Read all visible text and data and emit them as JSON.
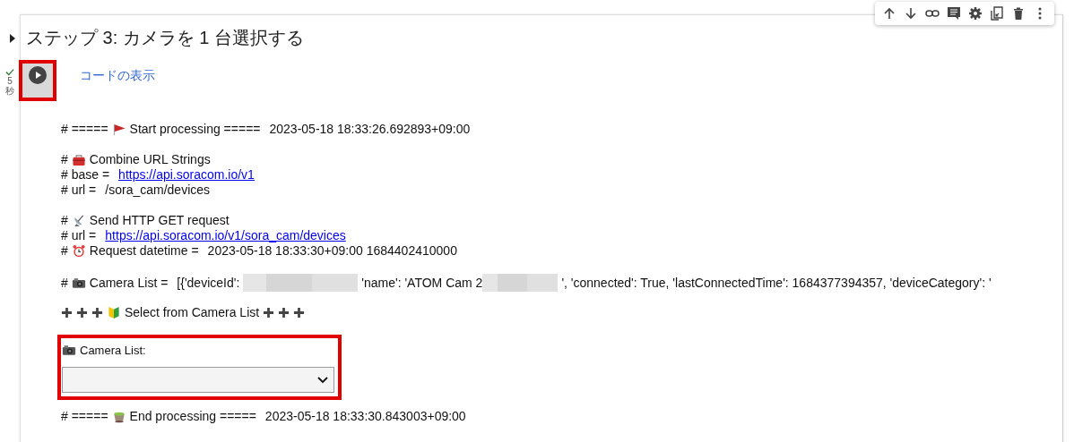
{
  "cell": {
    "heading": "ステップ 3: カメラを 1 台選択する",
    "status": {
      "done": true,
      "duration": "5",
      "unit": "秒"
    },
    "show_code": "コードの表示"
  },
  "output": {
    "start": {
      "prefix": "# =====",
      "text": "Start processing =====",
      "time": "2023-05-18 18:33:26.692893+09:00"
    },
    "combine": {
      "prefix": "#",
      "text": "Combine URL Strings"
    },
    "base": {
      "label": "# base =",
      "link": "https://api.soracom.io/v1"
    },
    "url": {
      "label": "# url =",
      "value": "/sora_cam/devices"
    },
    "send": {
      "prefix": "#",
      "text": "Send HTTP GET request"
    },
    "request_url": {
      "label": "# url =",
      "link": "https://api.soracom.io/v1/sora_cam/devices"
    },
    "request_datetime": {
      "prefix": "#",
      "text": "Request datetime =",
      "value": "2023-05-18 18:33:30+09:00 1684402410000"
    },
    "camera_list": {
      "prefix": "#",
      "label": "Camera List =",
      "part_1": "[{'deviceId':",
      "part_2": "'name': 'ATOM Cam 2",
      "part_3": "', 'connected': True, 'lastConnectedTime': 1684377394357, 'deviceCategory': '"
    },
    "select_heading": {
      "text": "Select from Camera List"
    },
    "dropdown": {
      "label": "Camera List:"
    },
    "end": {
      "prefix": "# =====",
      "text": "End processing =====",
      "time": "2023-05-18 18:33:30.843003+09:00"
    }
  }
}
